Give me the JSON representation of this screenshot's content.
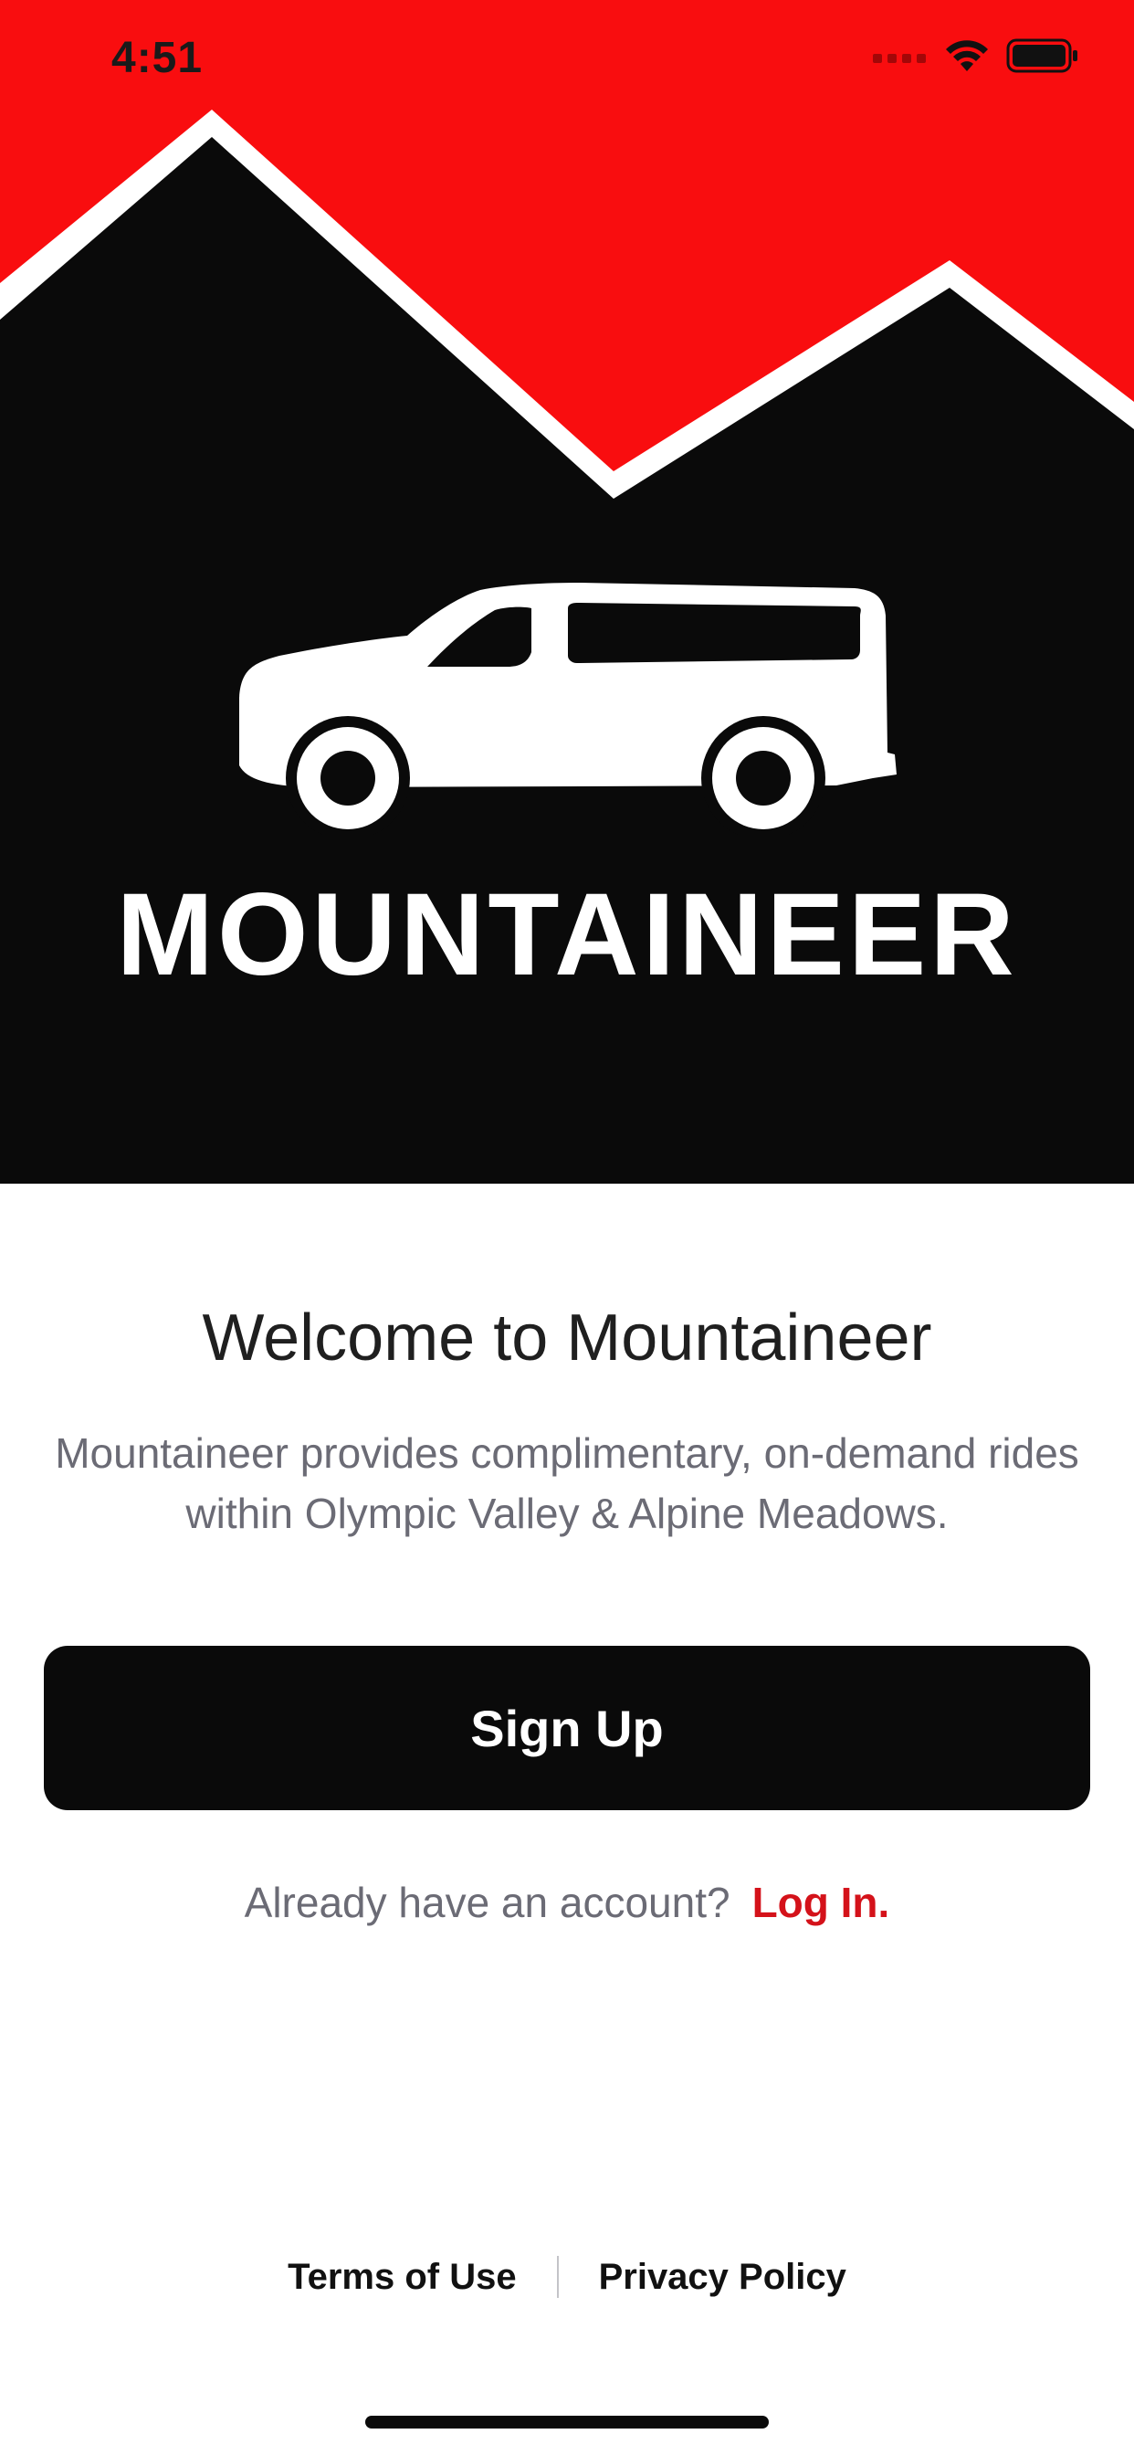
{
  "status_bar": {
    "time": "4:51",
    "icons": [
      "cellular-signal-icon",
      "wifi-icon",
      "battery-icon"
    ]
  },
  "hero": {
    "brand_name": "MOUNTAINEER",
    "colors": {
      "sky": "#f90d0f",
      "mountain": "#0a0a0a",
      "ridge": "#ffffff",
      "brand_text": "#ffffff"
    },
    "illustration": "van-icon"
  },
  "welcome": {
    "title": "Welcome to Mountaineer",
    "description": "Mountaineer provides complimentary, on-demand rides within Olympic Valley & Alpine Meadows."
  },
  "actions": {
    "signup_label": "Sign Up",
    "login_prompt": "Already have an account?",
    "login_label": "Log In."
  },
  "footer": {
    "terms_label": "Terms of Use",
    "privacy_label": "Privacy Policy"
  },
  "colors": {
    "accent": "#d4121a",
    "button_bg": "#0a0a0a",
    "body_text": "#6b6b75"
  }
}
